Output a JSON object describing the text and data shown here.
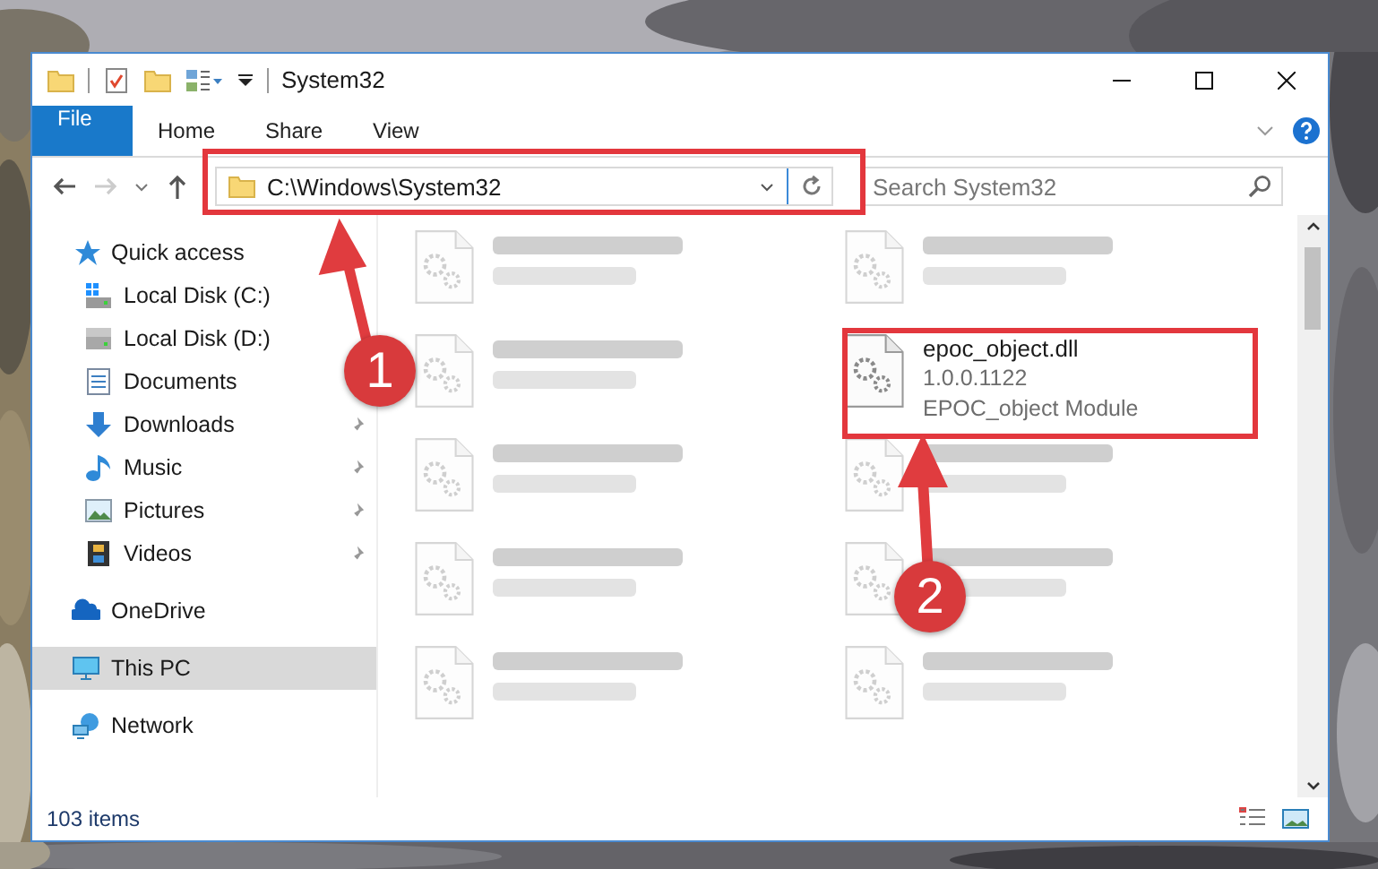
{
  "window": {
    "title": "System32"
  },
  "ribbon_tabs": [
    {
      "label": "File",
      "kind": "file",
      "selected": false
    },
    {
      "label": "Home",
      "kind": "tab",
      "selected": false
    },
    {
      "label": "Share",
      "kind": "tab",
      "selected": false
    },
    {
      "label": "View",
      "kind": "tab",
      "selected": false
    }
  ],
  "address": {
    "value": "C:\\Windows\\System32"
  },
  "search": {
    "placeholder": "Search System32"
  },
  "nav": {
    "items": [
      {
        "label": "Quick access",
        "kind": "star",
        "selected": false,
        "children": [
          {
            "label": "Local Disk (C:)",
            "kind": "system-drive",
            "selected": false,
            "pinned": false
          },
          {
            "label": "Local Disk (D:)",
            "kind": "drive",
            "selected": false,
            "pinned": false
          },
          {
            "label": "Documents",
            "kind": "documents",
            "selected": false,
            "pinned": false
          },
          {
            "label": "Downloads",
            "kind": "downloads",
            "selected": false,
            "pinned": true
          },
          {
            "label": "Music",
            "kind": "music",
            "selected": false,
            "pinned": true
          },
          {
            "label": "Pictures",
            "kind": "pictures",
            "selected": false,
            "pinned": true
          },
          {
            "label": "Videos",
            "kind": "videos",
            "selected": false,
            "pinned": true
          }
        ]
      },
      {
        "label": "OneDrive",
        "kind": "cloud",
        "selected": false
      },
      {
        "label": "This PC",
        "kind": "computer",
        "selected": true
      },
      {
        "label": "Network",
        "kind": "network",
        "selected": false
      }
    ]
  },
  "files": [
    {
      "blurred": true
    },
    {
      "blurred": true
    },
    {
      "blurred": true
    },
    {
      "name": "epoc_object.dll",
      "details": [
        "1.0.0.1122",
        "EPOC_object Module"
      ],
      "blurred": false
    },
    {
      "blurred": true
    },
    {
      "blurred": true
    },
    {
      "blurred": true
    },
    {
      "blurred": true
    },
    {
      "blurred": true
    },
    {
      "blurred": true
    }
  ],
  "status_bar": {
    "item_count": "103 items"
  },
  "annotations": [
    {
      "number": "1"
    },
    {
      "number": "2"
    }
  ]
}
